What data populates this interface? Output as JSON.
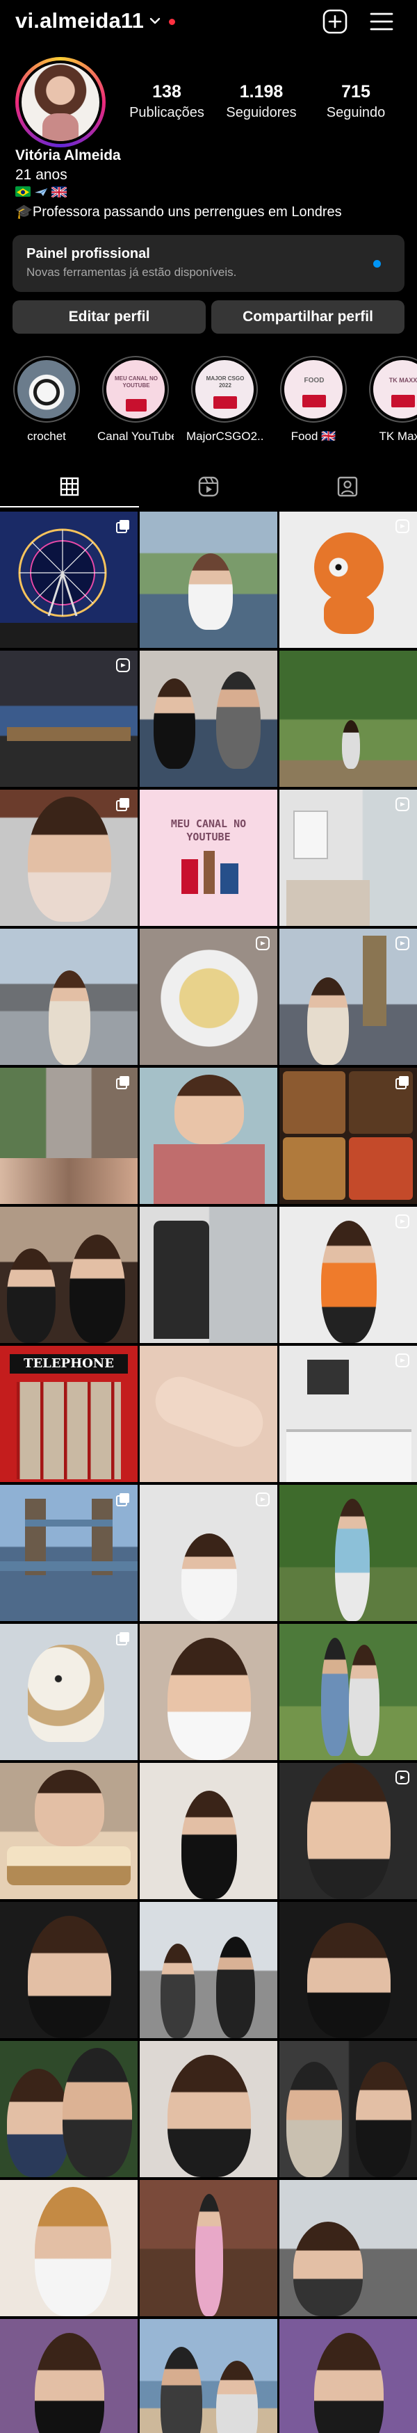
{
  "header": {
    "username": "vi.almeida11",
    "icons": [
      "chevron-down-icon",
      "notification-dot",
      "create-post-icon",
      "menu-icon"
    ]
  },
  "profile": {
    "full_name": "Vitória Almeida",
    "age": "21 anos",
    "flags": [
      "flag-brazil",
      "airplane",
      "flag-uk"
    ],
    "bio": "🎓Professora passando uns perrengues em Londres",
    "stats": [
      {
        "num": "138",
        "label": "Publicações"
      },
      {
        "num": "1.198",
        "label": "Seguidores"
      },
      {
        "num": "715",
        "label": "Seguindo"
      }
    ]
  },
  "panel": {
    "title": "Painel profissional",
    "subtitle": "Novas ferramentas já estão disponíveis."
  },
  "buttons": {
    "edit": "Editar perfil",
    "share": "Compartilhar perfil"
  },
  "highlights": [
    {
      "label": "crochet"
    },
    {
      "label": "Canal YouTube"
    },
    {
      "label": "MajorCSGO2..."
    },
    {
      "label": "Food 🇬🇧"
    },
    {
      "label": "TK Maxx"
    }
  ],
  "highlight_badges": {
    "youtube": "MEU CANAL NO YOUTUBE",
    "major": "MAJOR CSGO 2022",
    "food": "FOOD",
    "tk": "TK MAXX"
  },
  "tabs": [
    "grid-tab",
    "reels-tab",
    "tagged-tab"
  ],
  "grid_text": {
    "youtube_post": "MEU CANAL NO YOUTUBE",
    "telephone": "TELEPHONE"
  },
  "colors": {
    "accent_blue": "#0095f6",
    "notification_red": "#ff3040",
    "panel_bg": "#262626",
    "button_bg": "#363636"
  }
}
